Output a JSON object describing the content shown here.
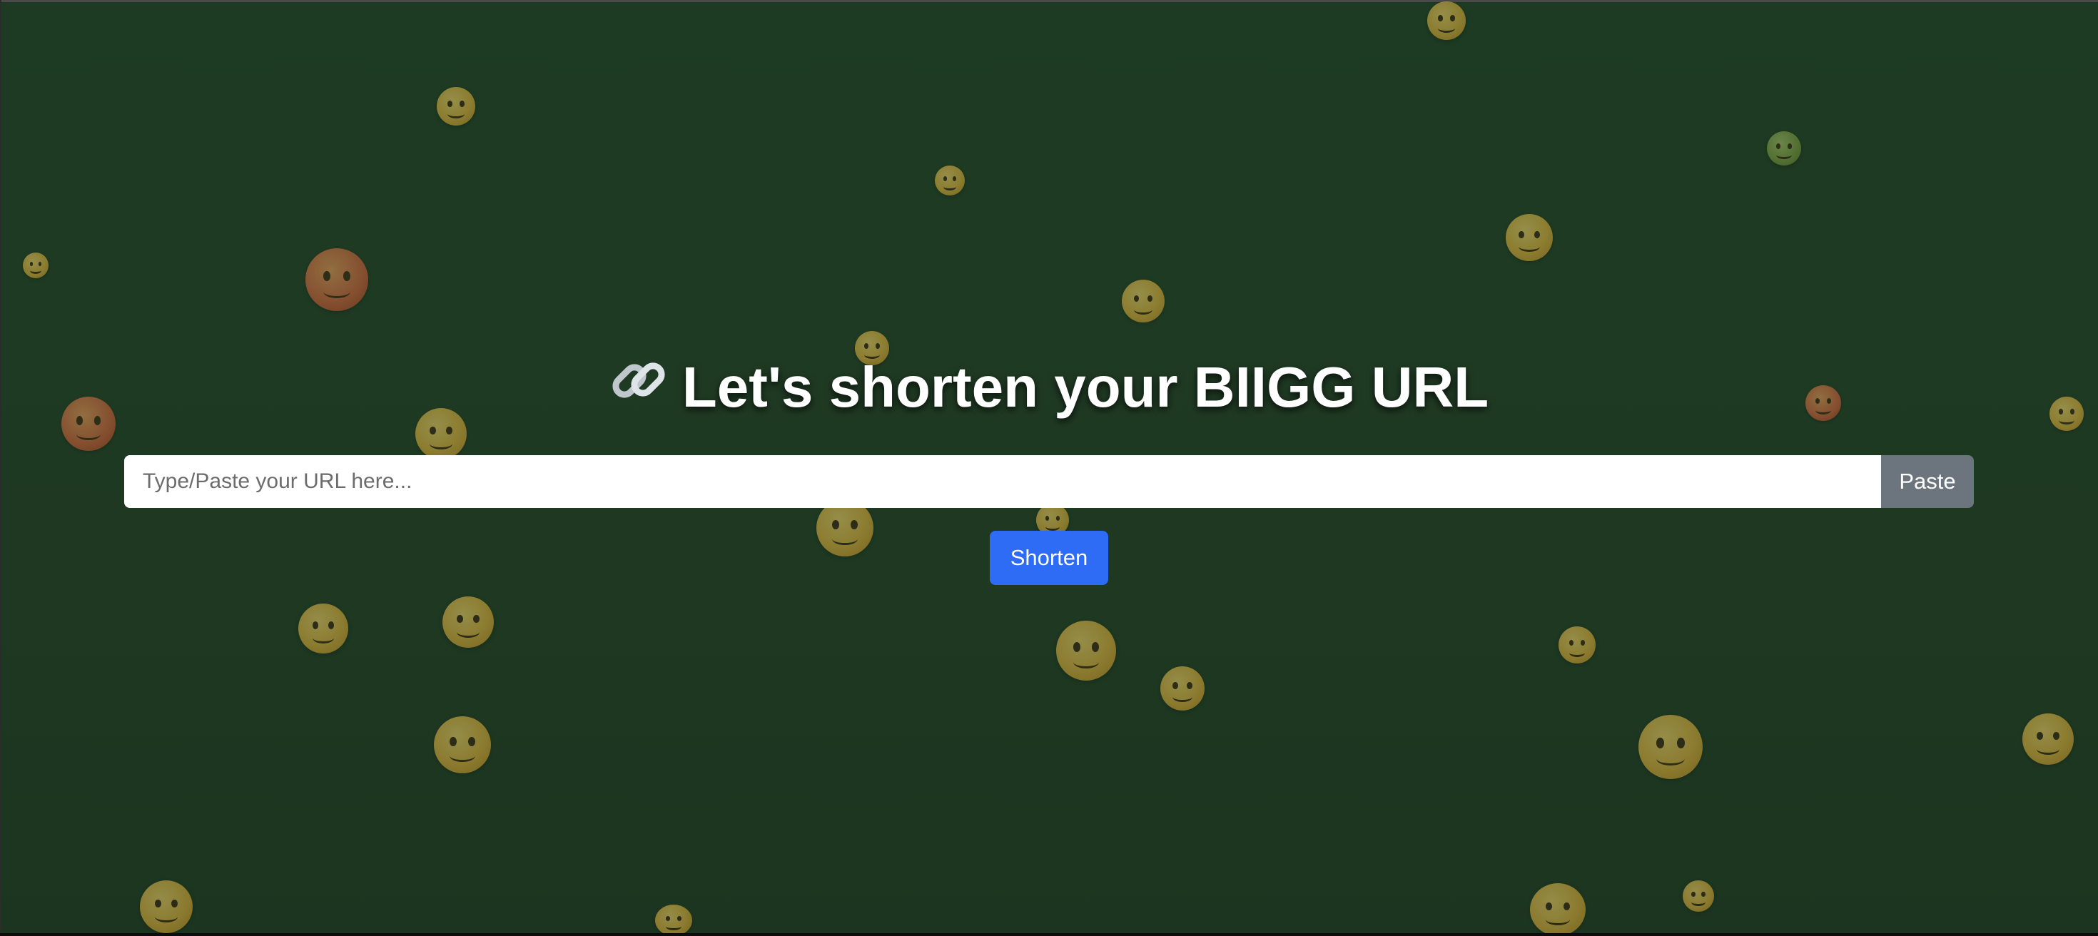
{
  "page": {
    "heading": "Let's shorten your BIIGG URL",
    "heading_icon": "link-icon"
  },
  "url_form": {
    "input_value": "",
    "input_placeholder": "Type/Paste your URL here...",
    "paste_label": "Paste",
    "shorten_label": "Shorten"
  },
  "colors": {
    "background": "#1f3a23",
    "primary_button": "#2f6cf6",
    "secondary_button": "#6c757d",
    "heading_text": "#ffffff"
  },
  "background_emojis": [
    "halo-face-icon",
    "star-struck-face-icon",
    "relieved-face-icon",
    "nauseated-face-icon",
    "grinning-face-icon",
    "smiling-face-icon",
    "angry-face-icon",
    "sleepy-face-icon",
    "neutral-face-icon",
    "angry-face-icon",
    "bandage-face-icon",
    "heart-eyes-face-icon",
    "smiling-face-icon",
    "laughing-face-icon",
    "frowning-face-icon",
    "exploding-head-icon",
    "zany-face-icon",
    "halo-face-icon",
    "halo-face-icon",
    "thinking-face-icon",
    "persevering-face-icon",
    "sweat-smile-face-icon",
    "laughing-face-icon",
    "nerd-face-icon",
    "crying-face-icon",
    "flushed-face-icon",
    "grin-face-icon"
  ]
}
